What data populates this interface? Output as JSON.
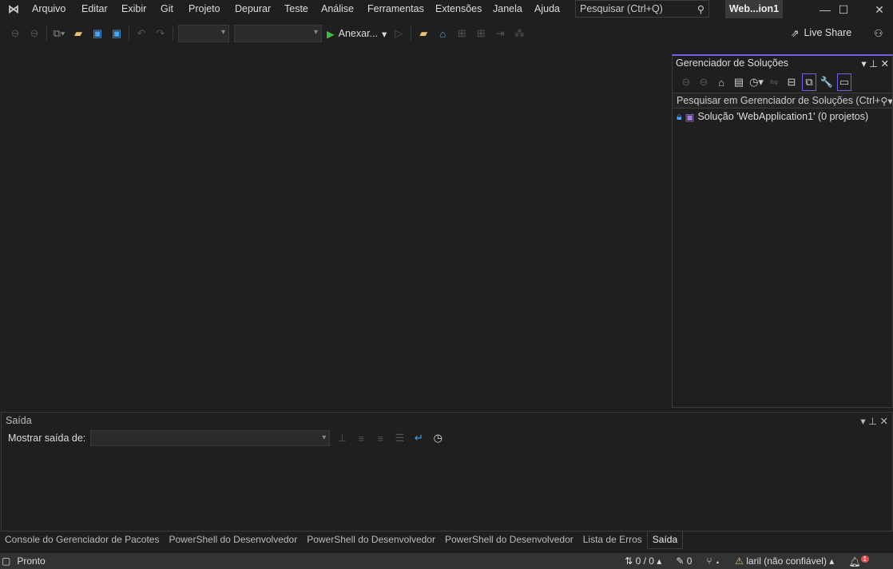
{
  "menubar": {
    "items": [
      "Arquivo",
      "Editar",
      "Exibir",
      "Git",
      "Projeto",
      "Depurar",
      "Teste",
      "Análise",
      "Ferramentas",
      "Extensões",
      "Janela",
      "Ajuda"
    ],
    "search_placeholder": "Pesquisar (Ctrl+Q)",
    "title": "Web...ion1"
  },
  "toolbar": {
    "run_label": "Anexar...",
    "live_share": "Live Share"
  },
  "solution_explorer": {
    "title": "Gerenciador de Soluções",
    "search_placeholder": "Pesquisar em Gerenciador de Soluções (Ctrl+",
    "root": "Solução 'WebApplication1' (0 projetos)",
    "accent": "#7160e8"
  },
  "output": {
    "title": "Saída",
    "show_from_label": "Mostrar saída de:",
    "source_value": ""
  },
  "tabs": [
    "Console do Gerenciador de Pacotes",
    "PowerShell do Desenvolvedor",
    "PowerShell do Desenvolvedor",
    "PowerShell do Desenvolvedor",
    "Lista de Erros",
    "Saída"
  ],
  "status": {
    "text": "Pronto",
    "sync": "0 / 0",
    "edits": "0",
    "user": "laril (não confiável)",
    "notifications": "1"
  }
}
